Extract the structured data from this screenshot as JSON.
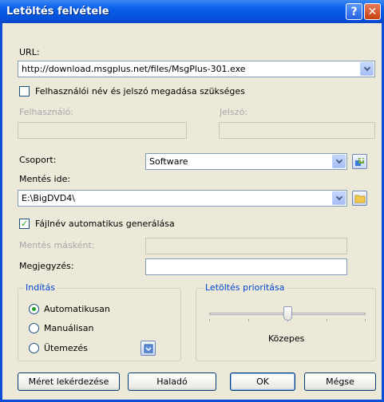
{
  "window": {
    "title": "Letöltés felvétele"
  },
  "url": {
    "label": "URL:",
    "value": "http://download.msgplus.net/files/MsgPlus-301.exe"
  },
  "credentials": {
    "checkbox_label": "Felhasználói név és jelszó megadása szükséges",
    "checked": false,
    "user_label": "Felhasználó:",
    "password_label": "Jelszó:",
    "user_value": "",
    "password_value": ""
  },
  "group": {
    "label": "Csoport:",
    "value": "Software"
  },
  "save_to": {
    "label": "Mentés ide:",
    "value": "E:\\BigDVD4\\"
  },
  "auto_name": {
    "checkbox_label": "Fájlnév automatikus generálása",
    "checked": true
  },
  "save_as": {
    "label": "Mentés másként:",
    "value": ""
  },
  "comment": {
    "label": "Megjegyzés:",
    "value": ""
  },
  "start": {
    "title": "Indítás",
    "options": [
      {
        "label": "Automatikusan",
        "selected": true
      },
      {
        "label": "Manuálisan",
        "selected": false
      },
      {
        "label": "Ütemezés",
        "selected": false
      }
    ]
  },
  "priority": {
    "title": "Letöltés prioritása",
    "value_label": "Közepes",
    "level": 0.5
  },
  "buttons": {
    "get_size": "Méret lekérdezése",
    "advanced": "Haladó",
    "ok": "OK",
    "cancel": "Mégse"
  },
  "icons": {
    "help": "?",
    "close": "✕",
    "check": "✓"
  }
}
